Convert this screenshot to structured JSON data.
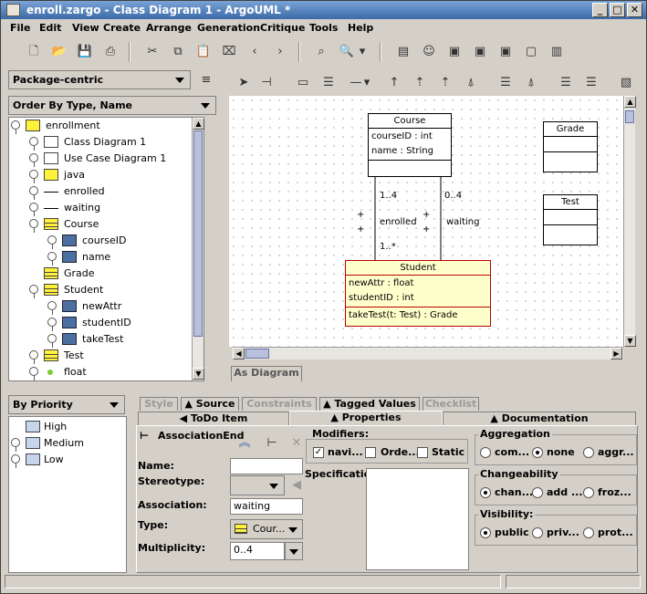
{
  "window": {
    "title": "enroll.zargo - Class Diagram 1 - ArgoUML *"
  },
  "menu": [
    {
      "label": "File"
    },
    {
      "label": "Edit"
    },
    {
      "label": "View"
    },
    {
      "label": "Create"
    },
    {
      "label": "Arrange"
    },
    {
      "label": "Generation"
    },
    {
      "label": "Critique"
    },
    {
      "label": "Tools"
    },
    {
      "label": "Help"
    }
  ],
  "explorer": {
    "perspective": "Package-centric",
    "order": "Order By Type, Name",
    "tree": [
      {
        "label": "enrollment",
        "icon": "folder-icon",
        "level": 0
      },
      {
        "label": "Class Diagram 1",
        "icon": "class-diagram-icon",
        "level": 1
      },
      {
        "label": "Use Case Diagram 1",
        "icon": "usecase-diagram-icon",
        "level": 1
      },
      {
        "label": "java",
        "icon": "folder-icon",
        "level": 1
      },
      {
        "label": "enrolled",
        "icon": "association-icon",
        "level": 1
      },
      {
        "label": "waiting",
        "icon": "association-icon",
        "level": 1
      },
      {
        "label": "Course",
        "icon": "class-icon",
        "level": 1
      },
      {
        "label": "courseID",
        "icon": "attribute-icon",
        "level": 2
      },
      {
        "label": "name",
        "icon": "attribute-icon",
        "level": 2
      },
      {
        "label": "Grade",
        "icon": "class-icon",
        "level": 1
      },
      {
        "label": "Student",
        "icon": "class-icon",
        "level": 1
      },
      {
        "label": "newAttr",
        "icon": "attribute-icon",
        "level": 2
      },
      {
        "label": "studentID",
        "icon": "attribute-icon",
        "level": 2
      },
      {
        "label": "takeTest",
        "icon": "operation-icon",
        "level": 2
      },
      {
        "label": "Test",
        "icon": "class-icon",
        "level": 1
      },
      {
        "label": "float",
        "icon": "datatype-icon",
        "level": 1
      }
    ]
  },
  "todo": {
    "priority": "By Priority",
    "items": [
      {
        "label": "High"
      },
      {
        "label": "Medium"
      },
      {
        "label": "Low"
      }
    ]
  },
  "diagram": {
    "tab": "As Diagram",
    "course": {
      "name": "Course",
      "attrs": [
        "courseID : int",
        "name : String"
      ]
    },
    "grade": {
      "name": "Grade"
    },
    "test": {
      "name": "Test"
    },
    "student": {
      "name": "Student",
      "attrs": [
        "newAttr : float",
        "studentID : int"
      ],
      "ops": [
        "takeTest(t: Test) : Grade"
      ]
    },
    "labels": {
      "m1": "1..4",
      "m2": "0..4",
      "m3": "1..*",
      "enrolled": "enrolled",
      "waiting": "waiting",
      "plus": "+"
    }
  },
  "details": {
    "tabs_top": [
      "Style",
      "Source",
      "Constraints",
      "Tagged Values",
      "Checklist"
    ],
    "tabs_bottom": [
      "ToDo Item",
      "Properties",
      "Documentation"
    ],
    "heading": "AssociationEnd",
    "name_label": "Name:",
    "name_value": "",
    "stereotype_label": "Stereotype:",
    "association_label": "Association:",
    "association_value": "waiting",
    "type_label": "Type:",
    "type_value": "Cour...",
    "multiplicity_label": "Multiplicity:",
    "multiplicity_value": "0..4",
    "modifiers_title": "Modifiers:",
    "modifiers": [
      {
        "label": "navi...",
        "checked": true
      },
      {
        "label": "Orde...",
        "checked": false
      },
      {
        "label": "Static",
        "checked": false
      }
    ],
    "specification_label": "Specification:",
    "aggregation_title": "Aggregation",
    "aggregation": [
      {
        "label": "com...",
        "on": false
      },
      {
        "label": "none",
        "on": true
      },
      {
        "label": "aggr...",
        "on": false
      }
    ],
    "changeability_title": "Changeability",
    "changeability": [
      {
        "label": "chan...",
        "on": true
      },
      {
        "label": "add ...",
        "on": false
      },
      {
        "label": "froz...",
        "on": false
      }
    ],
    "visibility_title": "Visibility:",
    "visibility": [
      {
        "label": "public",
        "on": true
      },
      {
        "label": "priv...",
        "on": false
      },
      {
        "label": "prot...",
        "on": false
      }
    ]
  }
}
